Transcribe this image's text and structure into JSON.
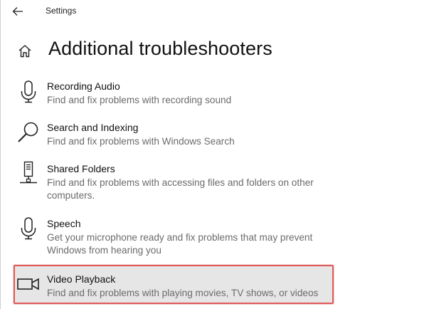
{
  "window": {
    "title": "Settings"
  },
  "page": {
    "title": "Additional troubleshooters"
  },
  "items": [
    {
      "name": "Recording Audio",
      "description": "Find and fix problems with recording sound",
      "icon": "microphone-icon"
    },
    {
      "name": "Search and Indexing",
      "description": "Find and fix problems with Windows Search",
      "icon": "search-icon"
    },
    {
      "name": "Shared Folders",
      "description": "Find and fix problems with accessing files and folders on other computers.",
      "icon": "network-computer-icon"
    },
    {
      "name": "Speech",
      "description": "Get your microphone ready and fix problems that may prevent Windows from hearing you",
      "icon": "microphone-icon"
    },
    {
      "name": "Video Playback",
      "description": "Find and fix problems with playing movies, TV shows, or videos",
      "icon": "video-camera-icon",
      "selected": true
    }
  ],
  "colors": {
    "highlight_border": "#e05a5a",
    "selected_background": "#e6e6e6",
    "description_text": "#6b6b6b"
  }
}
